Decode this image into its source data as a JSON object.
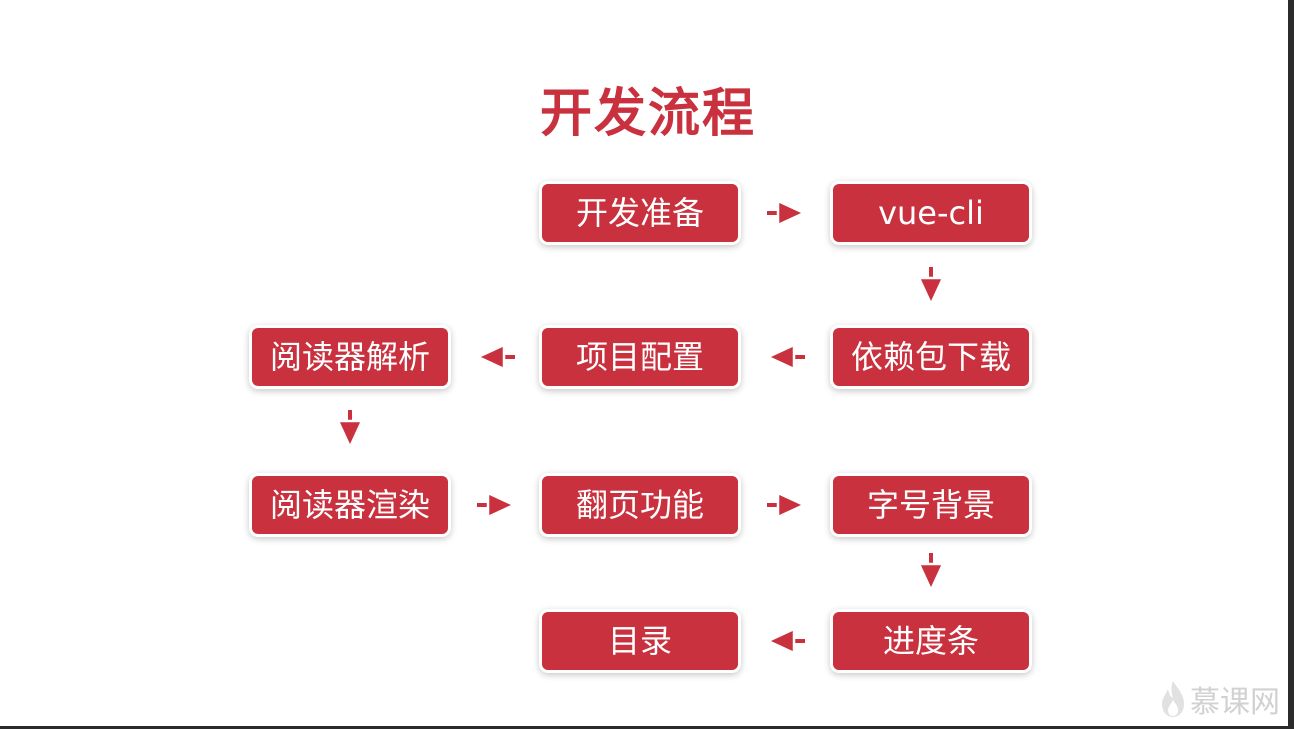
{
  "title": "开发流程",
  "colors": {
    "node_fill": "#c8313d",
    "arrow_fill": "#c8313d",
    "text_on_node": "#ffffff",
    "title_color": "#c8313d"
  },
  "nodes": {
    "prep": "开发准备",
    "vue_cli": "vue-cli",
    "deps": "依赖包下载",
    "config": "项目配置",
    "parse": "阅读器解析",
    "render": "阅读器渲染",
    "paging": "翻页功能",
    "font_bg": "字号背景",
    "progress": "进度条",
    "toc": "目录"
  },
  "watermark": {
    "text": "慕课网",
    "icon": "flame-icon"
  }
}
